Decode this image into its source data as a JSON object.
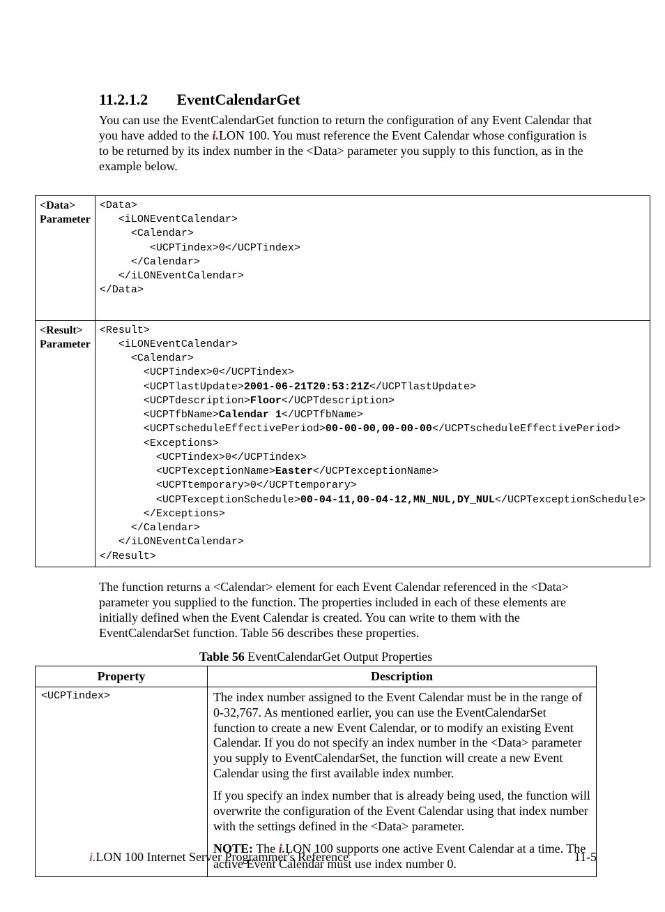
{
  "section": {
    "number": "11.2.1.2",
    "title": "EventCalendarGet"
  },
  "intro": {
    "pre": "You can use the EventCalendarGet function to return the configuration of any Event Calendar that you have added to the ",
    "i": "i.",
    "post": "LON 100. You must reference the Event Calendar whose configuration is to be returned by its index number in the <Data> parameter you supply to this function, as in the example below."
  },
  "codebox": {
    "row1_label_a": "<Data>",
    "row1_label_b": "Parameter",
    "row1_code": "<Data>\n   <iLONEventCalendar>\n     <Calendar>\n        <UCPTindex>0</UCPTindex>\n     </Calendar>\n   </iLONEventCalendar>\n</Data>",
    "row2_label_a": "<Result>",
    "row2_label_b": "Parameter",
    "row2_code_plain": [
      "<Result>",
      "   <iLONEventCalendar>",
      "     <Calendar>",
      "       <UCPTindex>0</UCPTindex>",
      "       <UCPTlastUpdate>",
      "2001-06-21T20:53:21Z",
      "</UCPTlastUpdate>",
      "       <UCPTdescription>",
      "Floor",
      "</UCPTdescription>",
      "       <UCPTfbName>",
      "Calendar 1",
      "</UCPTfbName>",
      "       <UCPTscheduleEffectivePeriod>",
      "00-00-00,00-00-00",
      "</UCPTscheduleEffectivePeriod>",
      "       <Exceptions>",
      "         <UCPTindex>0</UCPTindex>",
      "         <UCPTexceptionName>",
      "Easter",
      "</UCPTexceptionName>",
      "         <UCPTtemporary>0</UCPTtemporary>",
      "         <UCPTexceptionSchedule>",
      "00-04-11,00-04-12,MN_NUL,DY_NUL",
      "</UCPTexceptionSchedule>",
      "       </Exceptions>",
      "     </Calendar>",
      "   </iLONEventCalendar>",
      "</Result>"
    ]
  },
  "after_box": "The function returns a <Calendar> element for each Event Calendar referenced in the <Data> parameter you supplied to the function. The properties included in each of these elements are initially defined when the Event Calendar is created. You can write to them with the EventCalendarSet function. Table 56 describes these properties.",
  "table_caption_bold": "Table 56",
  "table_caption_rest": "   EventCalendarGet Output Properties",
  "table_headers": {
    "c1": "Property",
    "c2": "Description"
  },
  "table_row1": {
    "prop": "<UCPTindex>",
    "p1": "The index number assigned to the Event Calendar must be in the range of 0-32,767. As mentioned earlier, you can use the EventCalendarSet function to create a new Event Calendar, or to modify an existing Event Calendar. If you do not specify an index number in the <Data> parameter you supply to EventCalendarSet, the function will create a new Event Calendar using the first available index number.",
    "p2": "If you specify an index number that is already being used, the function will overwrite the configuration of the Event Calendar using that index number with the settings defined in the <Data> parameter.",
    "p3_note": "NOTE:",
    "p3_pre": " The ",
    "p3_i": "i.",
    "p3_post": "LON 100 supports one active Event Calendar at a time. The active Event Calendar must use index number 0."
  },
  "footer": {
    "left_i": "i.",
    "left_rest": "LON 100 Internet Server Programmer's Reference",
    "right": "11-5"
  }
}
